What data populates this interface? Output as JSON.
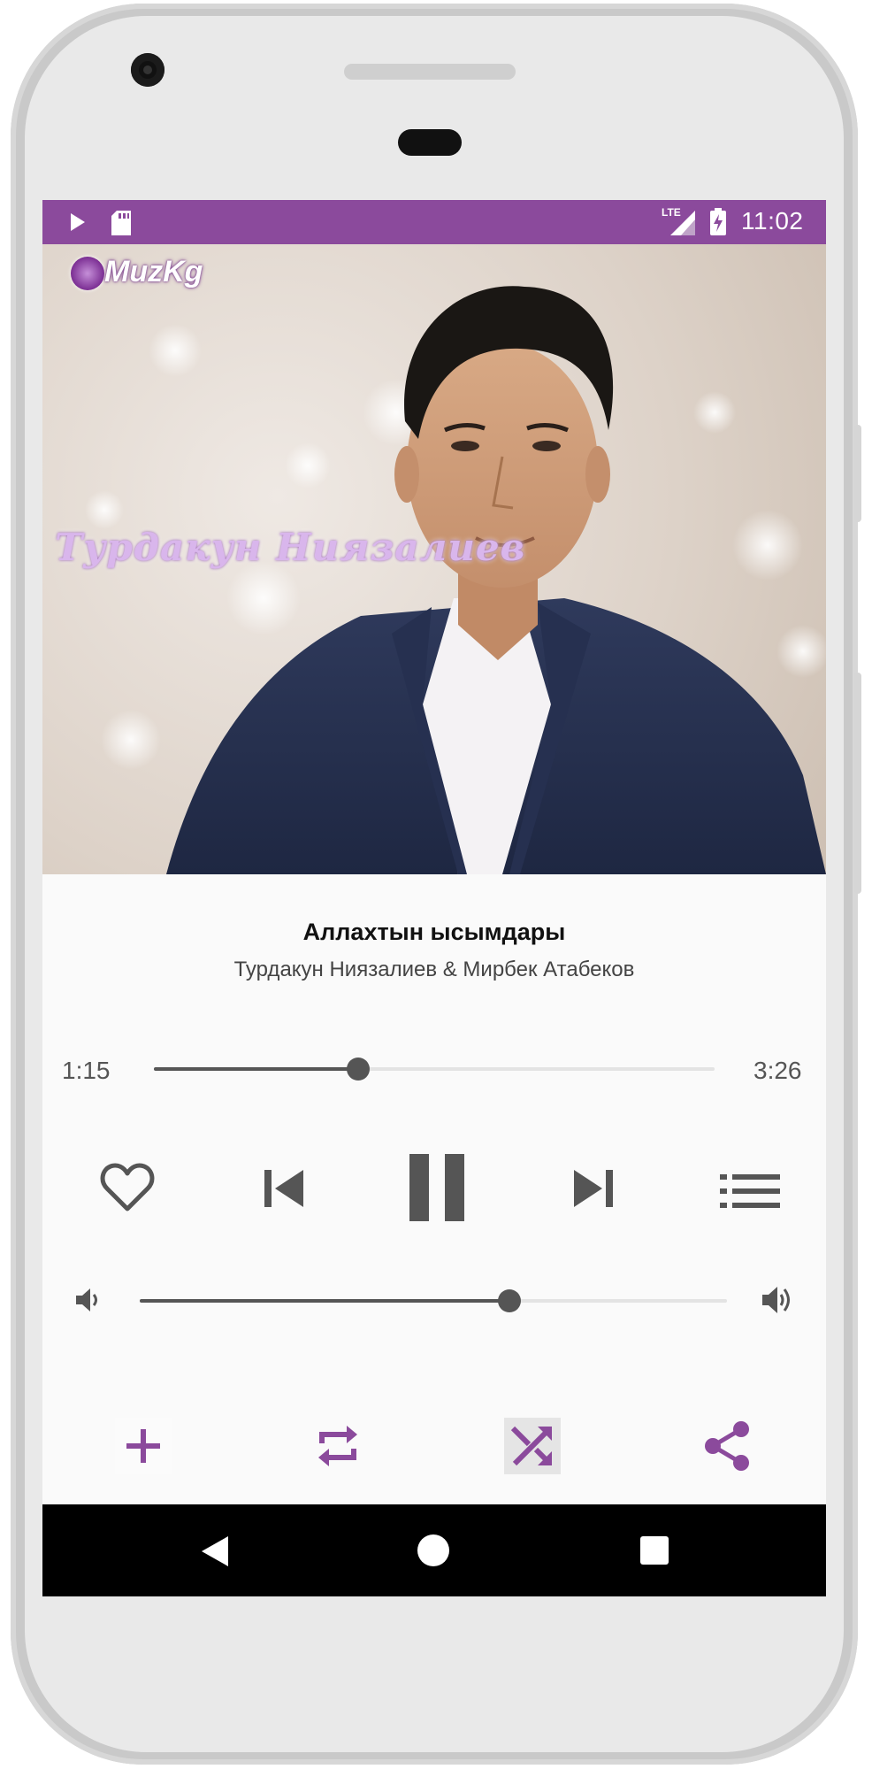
{
  "status_bar": {
    "time": "11:02",
    "network": "LTE",
    "icons": [
      "play-icon",
      "sd-card-icon",
      "lte-signal-icon",
      "battery-charging-icon"
    ]
  },
  "album_art": {
    "logo": "MuzKg",
    "caption": "Турдакун Ниязалиев"
  },
  "track": {
    "title": "Аллахтын ысымдары",
    "artist": "Турдакун Ниязалиев & Мирбек Атабеков"
  },
  "progress": {
    "elapsed": "1:15",
    "total": "3:26",
    "fraction": 0.364
  },
  "volume": {
    "fraction": 0.63
  },
  "controls": [
    "heart-icon",
    "skip-previous-icon",
    "pause-icon",
    "skip-next-icon",
    "queue-list-icon"
  ],
  "actions": [
    "add-icon",
    "repeat-icon",
    "shuffle-icon",
    "share-icon"
  ],
  "colors": {
    "accent": "#8b4a9c",
    "icon_gray": "#555555",
    "nav_bar": "#000000"
  }
}
